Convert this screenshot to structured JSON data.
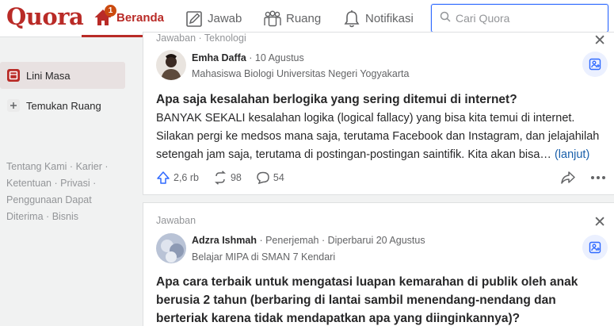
{
  "header": {
    "logo": "Quora",
    "nav": {
      "home": {
        "label": "Beranda",
        "badge": "1"
      },
      "answer": {
        "label": "Jawab"
      },
      "spaces": {
        "label": "Ruang"
      },
      "notifications": {
        "label": "Notifikasi"
      }
    },
    "search": {
      "placeholder": "Cari Quora",
      "value": ""
    }
  },
  "sidebar": {
    "items": [
      {
        "label": "Lini Masa",
        "active": true
      },
      {
        "label": "Temukan Ruang",
        "active": false
      }
    ],
    "footer_links": [
      "Tentang Kami",
      "Karier",
      "Ketentuan",
      "Privasi",
      "Penggunaan Dapat Diterima",
      "Bisnis"
    ],
    "footer_sep": "·"
  },
  "feed": [
    {
      "context": "Jawaban · Teknologi",
      "author": "Emha Daffa",
      "meta": " · 10 Agustus",
      "credential": "Mahasiswa Biologi Universitas Negeri Yogyakarta",
      "question": "Apa saja kesalahan berlogika yang sering ditemui di internet?",
      "snippet": "BANYAK SEKALI kesalahan logika (logical fallacy) yang bisa kita temui di internet. Silakan pergi ke medsos mana saja, terutama Facebook dan Instagram, dan jelajahilah setengah jam saja, terutama di postingan-postingan saintifik. Kita akan bisa…",
      "more": "(lanjut)",
      "upvotes": "2,6 rb",
      "shares": "98",
      "comments": "54"
    },
    {
      "context": "Jawaban",
      "author": "Adzra Ishmah",
      "meta": " · Penerjemah · Diperbarui 20 Agustus",
      "credential": "Belajar MIPA di SMAN 7 Kendari",
      "question": "Apa cara terbaik untuk mengatasi luapan kemarahan di publik oleh anak berusia 2 tahun (berbaring di lantai sambil menendang-nendang dan berteriak karena tidak mendapatkan apa yang diinginkannya)?"
    }
  ],
  "colors": {
    "brand": "#b92b27",
    "accent": "#2e69ff",
    "link": "#195faa"
  },
  "icons": [
    "home-icon",
    "pencil-icon",
    "people-icon",
    "bell-icon",
    "search-icon",
    "timeline-icon",
    "plus-icon",
    "close-icon",
    "follow-icon",
    "upvote-icon",
    "share-icon",
    "comment-icon",
    "forward-icon",
    "more-icon"
  ]
}
